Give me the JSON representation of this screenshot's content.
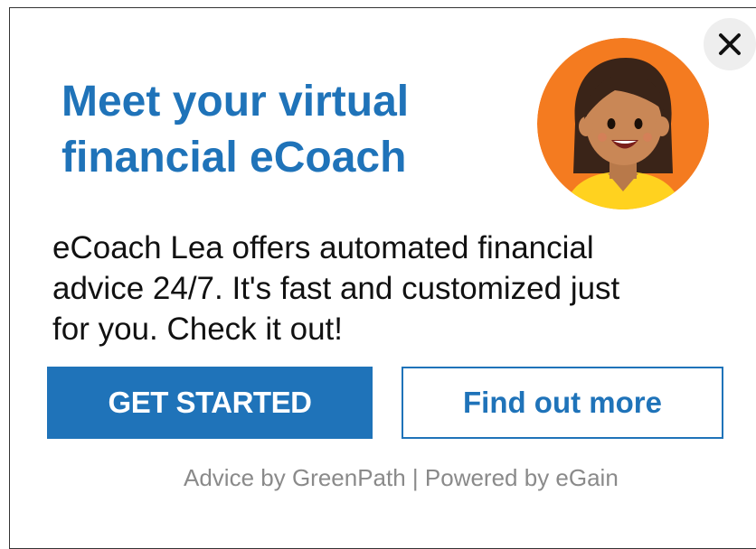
{
  "dialog": {
    "close_icon": "close-icon",
    "title_line1": "Meet your virtual",
    "title_line2": "financial eCoach",
    "avatar_icon": "woman-avatar-icon",
    "body_line1": "eCoach Lea offers automated financial",
    "body_line2": "advice 24/7. It's fast and customized just",
    "body_line3": "for you. Check it out!",
    "primary_button": "GET STARTED",
    "secondary_button": "Find out more",
    "footer": "Advice by GreenPath | Powered by eGain"
  },
  "colors": {
    "accent": "#1f73b9",
    "avatar_background": "#f47b20",
    "footer_text": "#8a8a8a"
  }
}
